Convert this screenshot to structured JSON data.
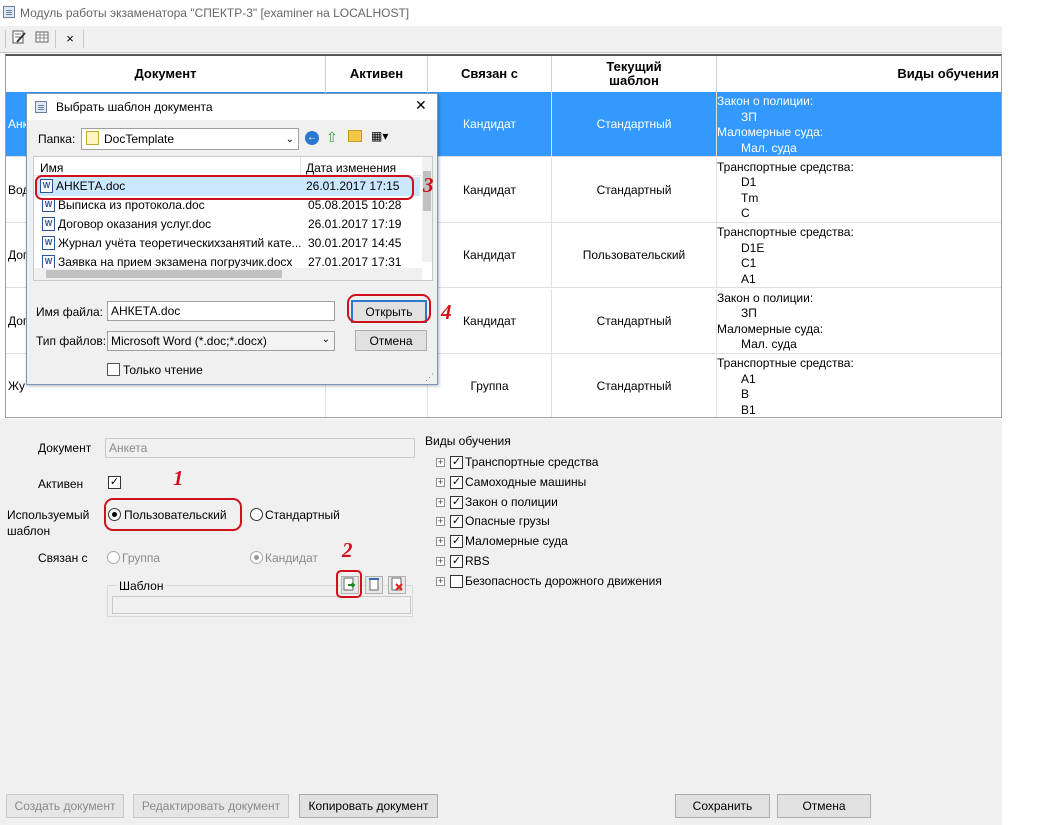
{
  "window": {
    "title": "Модуль работы экзаменатора \"СПЕКТР-3\" [examiner на LOCALHOST]"
  },
  "toolbar": {
    "close_label": "×"
  },
  "grid": {
    "columns": [
      "Документ",
      "Активен",
      "Связан с",
      "Текущий шаблон",
      "Виды обучения"
    ],
    "rows": [
      {
        "doc": "Анк",
        "linked": "Кандидат",
        "template": "Стандартный",
        "types": [
          {
            "cat": "Закон о полиции:",
            "items": [
              "ЗП"
            ]
          },
          {
            "cat": "Маломерные суда:",
            "items": [
              "Мал. суда"
            ]
          }
        ]
      },
      {
        "doc": "Вод",
        "linked": "Кандидат",
        "template": "Стандартный",
        "types": [
          {
            "cat": "Транспортные средства:",
            "items": [
              "D1",
              "Tm",
              "C"
            ]
          }
        ]
      },
      {
        "doc": "Дог",
        "linked": "Кандидат",
        "template": "Пользовательский",
        "types": [
          {
            "cat": "Транспортные средства:",
            "items": [
              "D1E",
              "C1",
              "A1"
            ]
          }
        ]
      },
      {
        "doc": "Дог",
        "linked": "Кандидат",
        "template": "Стандартный",
        "types": [
          {
            "cat": "Закон о полиции:",
            "items": [
              "ЗП"
            ]
          },
          {
            "cat": "Маломерные суда:",
            "items": [
              "Мал. суда"
            ]
          }
        ]
      },
      {
        "doc": "Жу",
        "linked": "Группа",
        "template": "Стандартный",
        "types": [
          {
            "cat": "Транспортные средства:",
            "items": [
              "A1",
              "B",
              "B1"
            ]
          }
        ]
      }
    ]
  },
  "form": {
    "document_label": "Документ",
    "document_value": "Анкета",
    "active_label": "Активен",
    "active_checked": true,
    "template_label_1": "Используемый",
    "template_label_2": "шаблон",
    "template_option_custom": "Пользовательский",
    "template_option_standard": "Стандартный",
    "linked_label": "Связан с",
    "linked_option_group": "Группа",
    "linked_option_candidate": "Кандидат",
    "template_group_label": "Шаблон",
    "template_path": ""
  },
  "training": {
    "label": "Виды обучения",
    "items": [
      {
        "label": "Транспортные средства",
        "checked": true
      },
      {
        "label": "Самоходные машины",
        "checked": true
      },
      {
        "label": "Закон о полиции",
        "checked": true
      },
      {
        "label": "Опасные грузы",
        "checked": true
      },
      {
        "label": "Маломерные суда",
        "checked": true
      },
      {
        "label": "RBS",
        "checked": true
      },
      {
        "label": "Безопасность дорожного движения",
        "checked": false
      }
    ]
  },
  "buttons": {
    "create": "Создать документ",
    "edit": "Редактировать документ",
    "copy": "Копировать документ",
    "save": "Сохранить",
    "cancel": "Отмена"
  },
  "dialog": {
    "title": "Выбрать шаблон документа",
    "folder_label": "Папка:",
    "folder_value": "DocTemplate",
    "col_name": "Имя",
    "col_date": "Дата изменения",
    "files": [
      {
        "name": "АНКЕТА.doc",
        "date": "26.01.2017 17:15"
      },
      {
        "name": "Выписка из протокола.doc",
        "date": "05.08.2015 10:28"
      },
      {
        "name": "Договор оказания услуг.doc",
        "date": "26.01.2017 17:19"
      },
      {
        "name": "Журнал учёта теоретическихзанятий кате...",
        "date": "30.01.2017 14:45"
      },
      {
        "name": "Заявка на прием экзамена погрузчик.docx",
        "date": "27.01.2017 17:31"
      }
    ],
    "filename_label": "Имя файла:",
    "filename_value": "АНКЕТА.doc",
    "filetype_label": "Тип файлов:",
    "filetype_value": "Microsoft Word (*.doc;*.docx)",
    "open_button": "Открыть",
    "cancel_button": "Отмена",
    "readonly_label": "Только чтение",
    "close_label": "✕"
  },
  "annotations": [
    "1",
    "2",
    "3",
    "4"
  ],
  "colors": {
    "selection": "#3399ff",
    "annotation": "#d0111c"
  }
}
